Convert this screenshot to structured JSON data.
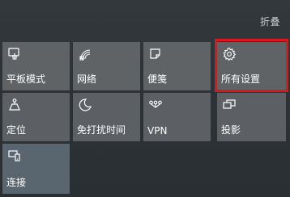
{
  "header": {
    "collapse_label": "折叠"
  },
  "tiles": [
    {
      "label": "平板模式",
      "icon": "tablet-mode-icon"
    },
    {
      "label": "网络",
      "icon": "network-icon"
    },
    {
      "label": "便笺",
      "icon": "note-icon"
    },
    {
      "label": "所有设置",
      "icon": "gear-icon"
    },
    {
      "label": "定位",
      "icon": "location-icon"
    },
    {
      "label": "免打扰时间",
      "icon": "moon-icon"
    },
    {
      "label": "VPN",
      "icon": "vpn-icon"
    },
    {
      "label": "投影",
      "icon": "project-icon"
    },
    {
      "label": "连接",
      "icon": "connect-icon"
    }
  ],
  "colors": {
    "highlight": "#e0141b",
    "tile": "#5f6366",
    "background": "#2c3135"
  }
}
